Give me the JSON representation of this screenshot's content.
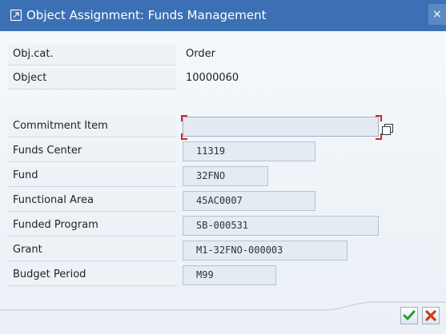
{
  "window": {
    "title": "Object Assignment: Funds Management",
    "close_glyph": "×"
  },
  "header": {
    "obj_cat_label": "Obj.cat.",
    "obj_cat_value": "Order",
    "object_label": "Object",
    "object_value": "10000060"
  },
  "fields": {
    "commitment_item": {
      "label": "Commitment Item",
      "value": ""
    },
    "funds_center": {
      "label": "Funds Center",
      "value": "11319"
    },
    "fund": {
      "label": "Fund",
      "value": "32FNO"
    },
    "functional_area": {
      "label": "Functional Area",
      "value": "45AC0007"
    },
    "funded_program": {
      "label": "Funded Program",
      "value": "SB-000531"
    },
    "grant": {
      "label": "Grant",
      "value": "M1-32FNO-000003"
    },
    "budget_period": {
      "label": "Budget Period",
      "value": "M99"
    }
  },
  "icons": {
    "title": "dialog-icon",
    "copy": "copy-icon",
    "confirm": "checkmark-icon",
    "cancel": "cancel-icon"
  },
  "colors": {
    "title_bar": "#3c70b4",
    "required_marker": "#d6242a",
    "confirm": "#2e9a2e",
    "cancel": "#d23a1d"
  }
}
